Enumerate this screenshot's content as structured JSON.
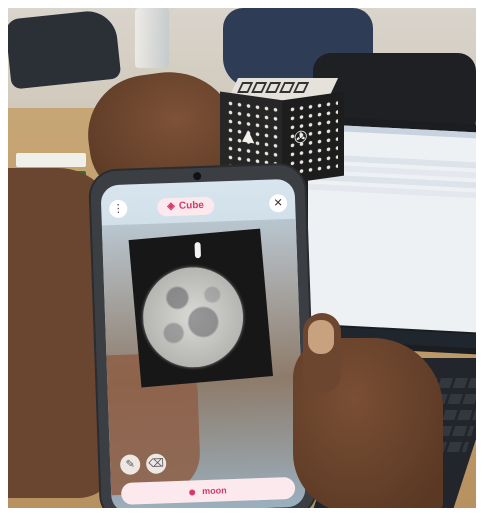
{
  "scene": {
    "description_colors": {
      "accent": "#d23b6a",
      "pill_bg": "#fbe9ee"
    }
  },
  "app": {
    "title": "Cube",
    "top_left_icon": "more-vertical-icon",
    "close_icon": "close-icon",
    "bottom_label": "moon",
    "tools": [
      {
        "icon": "pencil-icon"
      },
      {
        "icon": "eraser-icon"
      }
    ]
  },
  "icons": {
    "cube_symbol": "cube-icon"
  }
}
